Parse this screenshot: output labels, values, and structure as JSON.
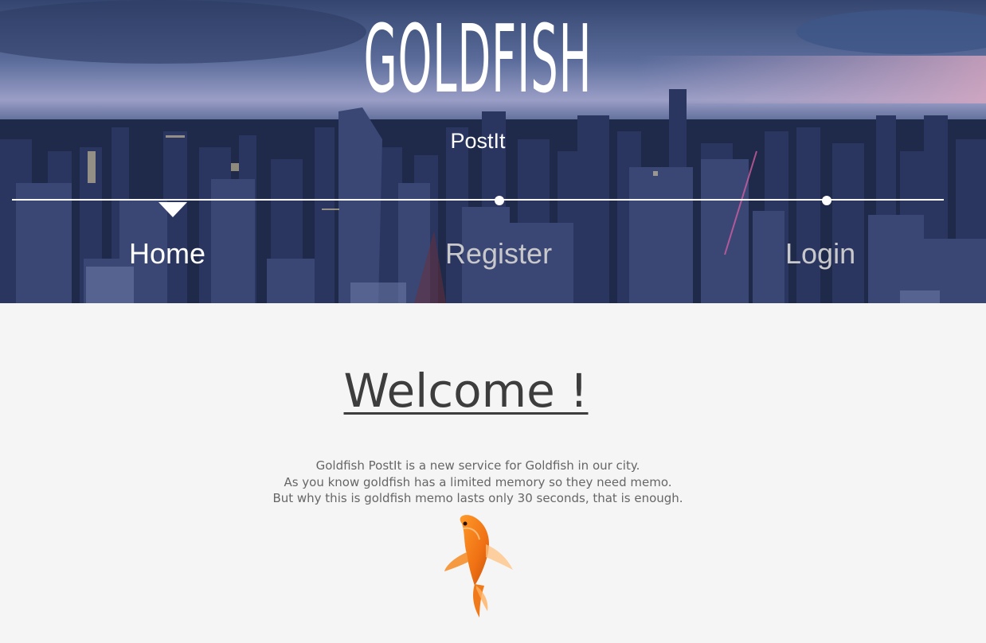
{
  "header": {
    "logo": "GOLDFISH",
    "subtitle": "PostIt"
  },
  "nav": {
    "items": [
      {
        "label": "Home",
        "active": true
      },
      {
        "label": "Register",
        "active": false
      },
      {
        "label": "Login",
        "active": false
      }
    ]
  },
  "main": {
    "heading": "Welcome !",
    "paragraph_lines": [
      "Goldfish PostIt is a new service for Goldfish in our city.",
      "As you know goldfish has a limited memory so they need memo.",
      "But why this is goldfish memo lasts only 30 seconds, that is enough."
    ]
  },
  "colors": {
    "page_background": "#f5f5f5",
    "nav_active": "#ffffff",
    "nav_inactive": "#c9c9cc",
    "heading": "#3d3d3d",
    "body_text": "#666666",
    "fish": "#f07a1a"
  },
  "icons": {
    "hero_image": "city-skyline-night",
    "illustration": "goldfish-image"
  }
}
